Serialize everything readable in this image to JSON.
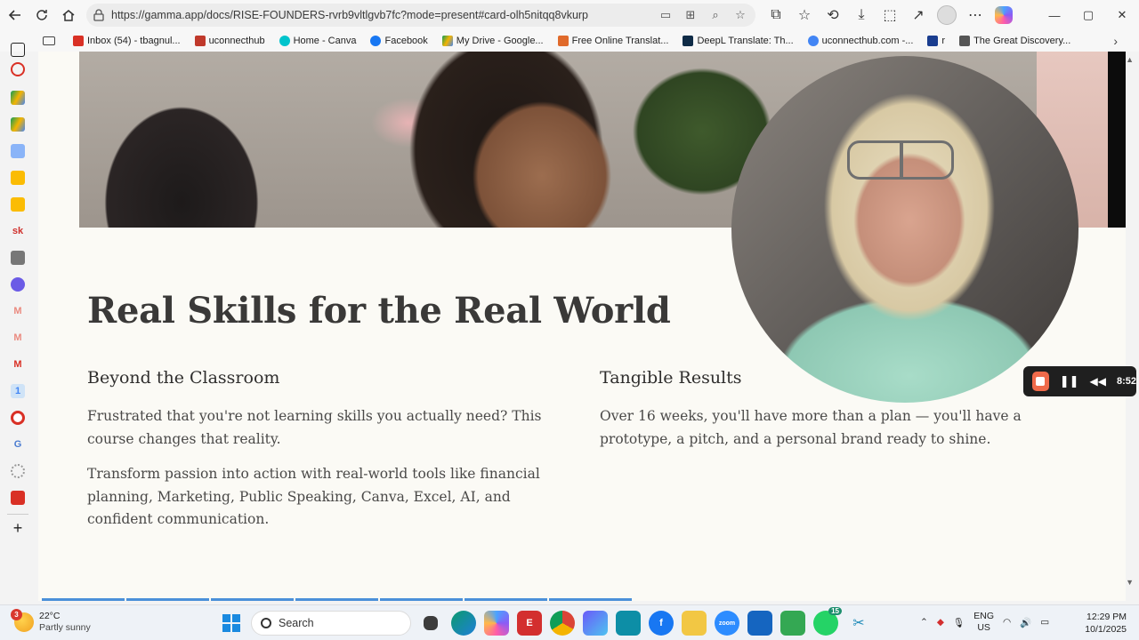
{
  "browser": {
    "url": "https://gamma.app/docs/RISE-FOUNDERS-rvrb9vltlgvb7fc?mode=present#card-olh5nitqq8vkurp",
    "bookmarks": [
      {
        "label": "",
        "color": "#444444"
      },
      {
        "label": "Inbox (54) - tbagnul...",
        "color": "#d93025"
      },
      {
        "label": "uconnecthub",
        "color": "#c0392b"
      },
      {
        "label": "Home - Canva",
        "color": "#00c4cc"
      },
      {
        "label": "Facebook",
        "color": "#1877f2"
      },
      {
        "label": "My Drive - Google...",
        "color": "#f4b400"
      },
      {
        "label": "Free Online Translat...",
        "color": "#e06a2b"
      },
      {
        "label": "DeepL Translate: Th...",
        "color": "#0f2b46"
      },
      {
        "label": "uconnecthub.com -...",
        "color": "#4285f4"
      },
      {
        "label": "r",
        "color": "#1a3d8f"
      },
      {
        "label": "The Great Discovery...",
        "color": "#555555"
      }
    ]
  },
  "slide": {
    "title": "Real Skills for the Real World",
    "left": {
      "heading": "Beyond the Classroom",
      "p1": "Frustrated that you're not learning skills you actually need? This course changes that reality.",
      "p2": "Transform passion into action with real-world tools like financial planning, Marketing, Public Speaking, Canva, Excel, AI, and confident communication."
    },
    "right": {
      "heading": "Tangible Results",
      "p1": "Over 16 weeks, you'll have more than a plan — you'll have a prototype, a pitch, and a personal brand ready to shine."
    },
    "progress_segments": 7,
    "progress_active": 7
  },
  "recorder": {
    "time": "8:52"
  },
  "taskbar": {
    "weather_badge": "3",
    "temperature": "22°C",
    "condition": "Partly sunny",
    "search_placeholder": "Search",
    "whatsapp_badge": "15",
    "lang_top": "ENG",
    "lang_bottom": "US",
    "time": "12:29 PM",
    "date": "10/1/2025"
  }
}
